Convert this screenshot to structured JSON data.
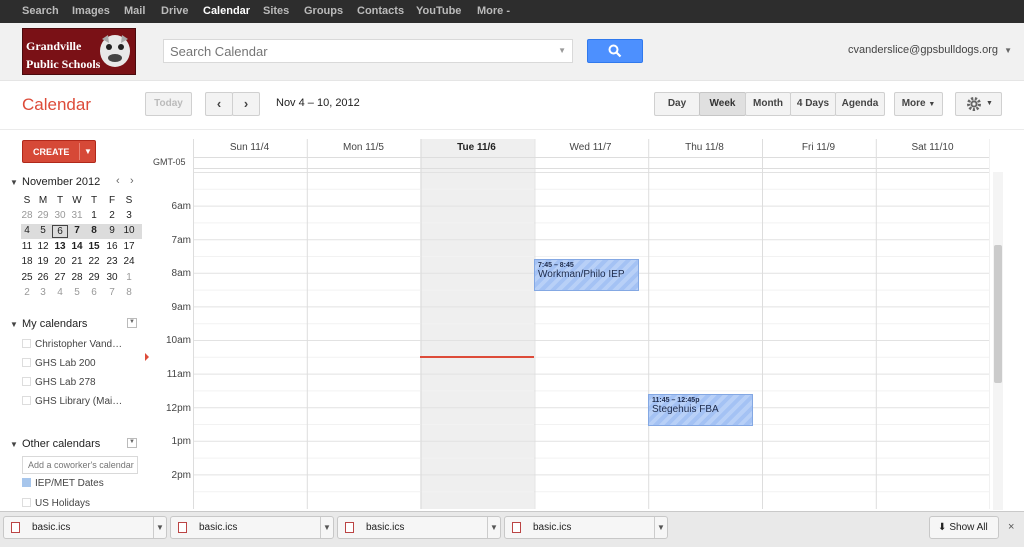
{
  "topnav": [
    "Search",
    "Images",
    "Mail",
    "Drive",
    "Calendar",
    "Sites",
    "Groups",
    "Contacts",
    "YouTube",
    "More -"
  ],
  "logo": {
    "line1": "Grandville",
    "line2": "Public Schools"
  },
  "search": {
    "placeholder": "Search Calendar"
  },
  "user": {
    "email": "cvanderslice@gpsbulldogs.org"
  },
  "app": {
    "title": "Calendar"
  },
  "toolbar": {
    "today": "Today",
    "range": "Nov 4 – 10, 2012",
    "views": [
      "Day",
      "Week",
      "Month",
      "4 Days",
      "Agenda"
    ],
    "more": "More"
  },
  "sidebar": {
    "create": "CREATE",
    "month": "November 2012",
    "dow": [
      "S",
      "M",
      "T",
      "W",
      "T",
      "F",
      "S"
    ],
    "weeks": [
      [
        "28",
        "29",
        "30",
        "31",
        "1",
        "2",
        "3"
      ],
      [
        "4",
        "5",
        "6",
        "7",
        "8",
        "9",
        "10"
      ],
      [
        "11",
        "12",
        "13",
        "14",
        "15",
        "16",
        "17"
      ],
      [
        "18",
        "19",
        "20",
        "21",
        "22",
        "23",
        "24"
      ],
      [
        "25",
        "26",
        "27",
        "28",
        "29",
        "30",
        "1"
      ],
      [
        "2",
        "3",
        "4",
        "5",
        "6",
        "7",
        "8"
      ]
    ],
    "my_calendars_title": "My calendars",
    "my_calendars": [
      "Christopher Vand…",
      "GHS Lab 200",
      "GHS Lab 278",
      "GHS Library (Mai…"
    ],
    "other_calendars_title": "Other calendars",
    "coworker_placeholder": "Add a coworker's calendar",
    "other_calendars": [
      "IEP/MET Dates",
      "US Holidays"
    ]
  },
  "grid": {
    "timezone": "GMT-05",
    "days": [
      "Sun 11/4",
      "Mon 11/5",
      "Tue 11/6",
      "Wed 11/7",
      "Thu 11/8",
      "Fri 11/9",
      "Sat 11/10"
    ],
    "hours": [
      "6am",
      "7am",
      "8am",
      "9am",
      "10am",
      "11am",
      "12pm",
      "1pm",
      "2pm"
    ],
    "events": [
      {
        "time": "7:45 – 8:45",
        "title": "Workman/Philo IEP"
      },
      {
        "time": "11:45 – 12:45p",
        "title": "Stegehuis FBA"
      }
    ]
  },
  "downloads": {
    "files": [
      "basic.ics",
      "basic.ics",
      "basic.ics",
      "basic.ics"
    ],
    "show_all": "Show All"
  },
  "colors": {
    "accent": "#dd4b39",
    "create": "#d64937",
    "search_button": "#4d90fe",
    "event": "#a4c2f4",
    "now_line": "#dd4b39"
  }
}
